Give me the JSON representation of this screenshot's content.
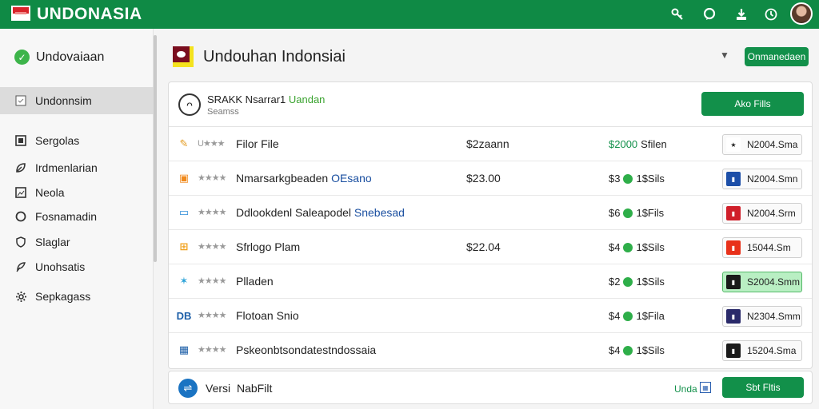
{
  "topbar": {
    "brand": "UNDONASIA",
    "icons": [
      "key-icon",
      "chat-icon",
      "download-icon",
      "clock-icon"
    ]
  },
  "sidebar": {
    "header": "Undovaiaan",
    "items": [
      {
        "label": "Undonnsim",
        "icon": "checkbox-icon",
        "active": true
      },
      {
        "label": "Sergolas",
        "icon": "grid-icon",
        "active": false
      },
      {
        "label": "Irdmenlarian",
        "icon": "leaf-icon",
        "active": false
      },
      {
        "label": "Neola",
        "icon": "image-icon",
        "active": false
      },
      {
        "label": "Fosnamadin",
        "icon": "circle-icon",
        "active": false
      },
      {
        "label": "Slaglar",
        "icon": "shield-icon",
        "active": false
      },
      {
        "label": "Unohsatis",
        "icon": "feather-icon",
        "active": false
      },
      {
        "label": "Sepkagass",
        "icon": "gear-icon",
        "active": false
      }
    ]
  },
  "main": {
    "title": "Undouhan Indonsiai",
    "header_button": "Onmanedaen"
  },
  "panel": {
    "head_title": "SRAKK Nsarrar1 ",
    "head_title_accent": "Uandan",
    "head_subtitle": "Seamss",
    "add_button": "Ako Fills",
    "rows": [
      {
        "icon": "pencil-icon",
        "icon_char": "✎",
        "icon_color": "#e39a1f",
        "stars": "★★★",
        "stars_prefix": "U",
        "name": "Filor File",
        "name_accent": "",
        "price": "$2zaann",
        "files_green": "$2000",
        "files_text": "Sfilen",
        "files_dot": false,
        "chip_label": "N2004.Sma",
        "chip_color": "#ffffff",
        "chip_mark": "★",
        "chip_mark_color": "#222",
        "highlight": false
      },
      {
        "icon": "app-orange-icon",
        "icon_char": "▣",
        "icon_color": "#f08a1d",
        "stars": "★★★★",
        "stars_prefix": "",
        "name": "Nmarsarkgbeaden ",
        "name_accent": "OEsano",
        "price": "$23.00",
        "files_green": "",
        "files_text": "1$Sils",
        "files_prefix": "$3",
        "files_dot": true,
        "chip_label": "N2004.Smn",
        "chip_color": "#1d4fa8",
        "chip_mark": "▮",
        "chip_mark_color": "#fff",
        "highlight": false
      },
      {
        "icon": "window-icon",
        "icon_char": "▭",
        "icon_color": "#2a8ad8",
        "stars": "★★★★",
        "stars_prefix": "",
        "name": "Ddlookdenl Saleapodel ",
        "name_accent": "Snebesad",
        "price": "",
        "files_green": "",
        "files_text": "1$Fils",
        "files_prefix": "$6",
        "files_dot": true,
        "chip_label": "N2004.Srm",
        "chip_color": "#d01f2a",
        "chip_mark": "▮",
        "chip_mark_color": "#fff",
        "highlight": false
      },
      {
        "icon": "grid-orange-icon",
        "icon_char": "⊞",
        "icon_color": "#f0a11d",
        "stars": "★★★★",
        "stars_prefix": "",
        "name": "Sfrlogo Plam",
        "name_accent": "",
        "price": "$22.04",
        "files_green": "",
        "files_text": "1$Sils",
        "files_prefix": "$4",
        "files_dot": true,
        "chip_label": "15044.Sm",
        "chip_color": "#e8311a",
        "chip_mark": "▮",
        "chip_mark_color": "#fff",
        "highlight": false
      },
      {
        "icon": "star-icon",
        "icon_char": "✶",
        "icon_color": "#2aa2d8",
        "stars": "★★★★",
        "stars_prefix": "",
        "name": "Plladen",
        "name_accent": "",
        "price": "",
        "files_green": "",
        "files_text": "1$Sils",
        "files_prefix": "$2",
        "files_dot": true,
        "chip_label": "S2004.Smm",
        "chip_color": "#1a1a1a",
        "chip_mark": "▮",
        "chip_mark_color": "#fff",
        "highlight": true
      },
      {
        "icon": "db-icon",
        "icon_char": "DB",
        "icon_color": "#1d5fa8",
        "stars": "★★★★",
        "stars_prefix": "",
        "name": "Flotoan Snio",
        "name_accent": "",
        "price": "",
        "files_green": "",
        "files_text": "1$Fila",
        "files_prefix": "$4",
        "files_dot": true,
        "chip_label": "N2304.Smm",
        "chip_color": "#2a2a6a",
        "chip_mark": "▮",
        "chip_mark_color": "#fff",
        "highlight": false
      },
      {
        "icon": "table-icon",
        "icon_char": "▦",
        "icon_color": "#1d5fa8",
        "stars": "★★★★",
        "stars_prefix": "",
        "name": "Pskeonbtsondatestndossaia",
        "name_accent": "",
        "price": "",
        "files_green": "",
        "files_text": "1$Sils",
        "files_prefix": "$4",
        "files_dot": true,
        "chip_label": "15204.Sma",
        "chip_color": "#1a1a1a",
        "chip_mark": "▮",
        "chip_mark_color": "#fff",
        "highlight": false
      }
    ]
  },
  "footer": {
    "version_label": "Versi",
    "file_label": "NabFilt",
    "green_text": "Unda",
    "button": "Sbt Fltis"
  }
}
